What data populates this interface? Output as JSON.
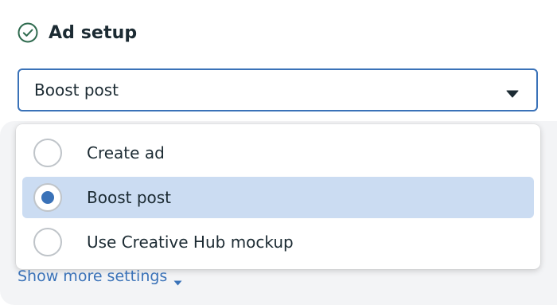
{
  "section": {
    "title": "Ad setup",
    "status_icon": "check-circle-icon"
  },
  "select": {
    "value": "Boost post",
    "caret_icon": "caret-down-icon"
  },
  "dropdown": {
    "options": [
      {
        "label": "Create ad",
        "selected": false
      },
      {
        "label": "Boost post",
        "selected": true
      },
      {
        "label": "Use Creative Hub mockup",
        "selected": false
      }
    ]
  },
  "more_settings": {
    "label": "Show more settings",
    "icon": "caret-down-icon"
  },
  "colors": {
    "accent": "#3a72b8",
    "selected_bg": "#cbdcf2",
    "text": "#1c2b33",
    "check": "#2f6b4f",
    "radio_border": "#bfc4c9"
  }
}
